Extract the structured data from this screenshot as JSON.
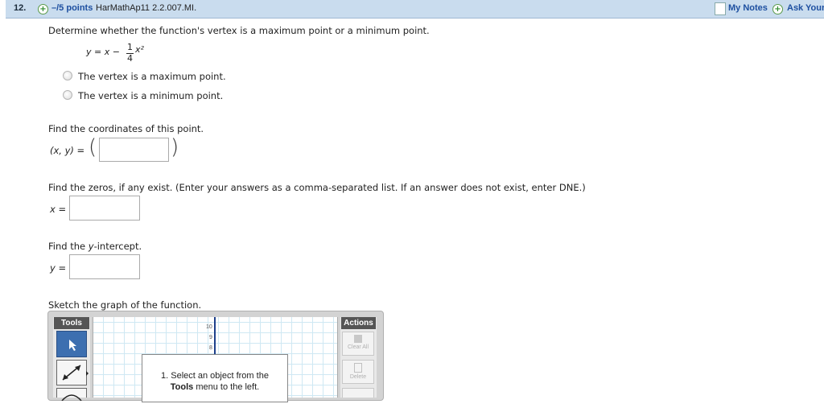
{
  "header": {
    "question_number": "12.",
    "points": "–/5 points",
    "question_id": "HarMathAp11 2.2.007.MI.",
    "my_notes": "My Notes",
    "ask_your": "Ask Your"
  },
  "part1": {
    "prompt": "Determine whether the function's vertex is a maximum point or a minimum point.",
    "equation_lhs": "y = x −",
    "fraction_num": "1",
    "fraction_den": "4",
    "equation_rhs": "x²",
    "options": [
      "The vertex is a maximum point.",
      "The vertex is a minimum point."
    ]
  },
  "part2": {
    "prompt": "Find the coordinates of this point.",
    "label": "(x, y) =",
    "value": ""
  },
  "part3": {
    "prompt": "Find the zeros, if any exist. (Enter your answers as a comma-separated list. If an answer does not exist, enter DNE.)",
    "label": "x =",
    "value": ""
  },
  "part4": {
    "prompt_pre": "Find the ",
    "prompt_var": "y",
    "prompt_post": "-intercept.",
    "label": "y =",
    "value": ""
  },
  "part5": {
    "prompt": "Sketch the graph of the function.",
    "tools_label": "Tools",
    "actions_label": "Actions",
    "clear_all": "Clear All",
    "delete": "Delete",
    "y_ticks": [
      "10",
      "9",
      "8"
    ],
    "instruction_line1": "1. Select an object from the",
    "instruction_tools": "Tools",
    "instruction_line2": " menu to the left."
  },
  "colors": {
    "header_bg": "#c9dcee",
    "link": "#1d4fa0",
    "toolbar_dark": "#555555",
    "selected_tool": "#3d6fb0"
  }
}
